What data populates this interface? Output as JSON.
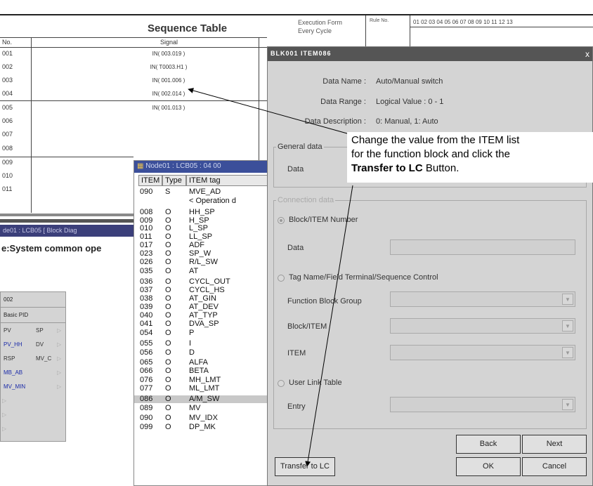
{
  "sequence_table": {
    "title": "Sequence Table",
    "exec_form_label": "Execution Form",
    "exec_form_value": "Every Cycle",
    "rule_no_label": "Rule No.",
    "rule_numbers": "01  02  03  04  05  06  07  08  09  10  11  12  13",
    "col_no": "No.",
    "col_signal": "Signal",
    "rows": [
      {
        "no": "001",
        "signal": "IN( 003.019 )"
      },
      {
        "no": "002",
        "signal": "IN( T0003.H1 )"
      },
      {
        "no": "003",
        "signal": "IN( 001.006 )"
      },
      {
        "no": "004",
        "signal": "IN( 002.014 )"
      },
      {
        "no": "005",
        "signal": "IN( 001.013 )"
      },
      {
        "no": "006",
        "signal": ""
      },
      {
        "no": "007",
        "signal": ""
      },
      {
        "no": "008",
        "signal": ""
      },
      {
        "no": "009",
        "signal": ""
      },
      {
        "no": "010",
        "signal": ""
      },
      {
        "no": "011",
        "signal": ""
      }
    ]
  },
  "block_diagram": {
    "title": "de01 : LCB05  [ Block Diag",
    "subtitle": "e:System common ope",
    "fb_header": "002",
    "fb_name": "Basic PID",
    "pins": [
      {
        "left": "PV",
        "right": "SP"
      },
      {
        "left": "PV_HH",
        "right": "DV"
      },
      {
        "left": "RSP",
        "right": "MV_C"
      },
      {
        "left": "MB_AB",
        "right": ""
      },
      {
        "left": "MV_MIN",
        "right": ""
      }
    ]
  },
  "item_list": {
    "title": "Node01 : LCB05 : 04 00",
    "headers": [
      "ITEM",
      "Type",
      "ITEM tag"
    ],
    "rows": [
      {
        "item": "090",
        "type": "S",
        "tag": "MVE_AD"
      },
      {
        "item": "",
        "type": "",
        "tag": "< Operation d"
      },
      {
        "item": "008",
        "type": "O",
        "tag": "HH_SP"
      },
      {
        "item": "009",
        "type": "O",
        "tag": "H_SP"
      },
      {
        "item": "010",
        "type": "O",
        "tag": "L_SP"
      },
      {
        "item": "011",
        "type": "O",
        "tag": "LL_SP"
      },
      {
        "item": "017",
        "type": "O",
        "tag": "ADF"
      },
      {
        "item": "023",
        "type": "O",
        "tag": "SP_W"
      },
      {
        "item": "026",
        "type": "O",
        "tag": "R/L_SW"
      },
      {
        "item": "035",
        "type": "O",
        "tag": "AT"
      },
      {
        "item": "036",
        "type": "O",
        "tag": "CYCL_OUT"
      },
      {
        "item": "037",
        "type": "O",
        "tag": "CYCL_HS"
      },
      {
        "item": "038",
        "type": "O",
        "tag": "AT_GIN"
      },
      {
        "item": "039",
        "type": "O",
        "tag": "AT_DEV"
      },
      {
        "item": "040",
        "type": "O",
        "tag": "AT_TYP"
      },
      {
        "item": "041",
        "type": "O",
        "tag": "DVA_SP"
      },
      {
        "item": "054",
        "type": "O",
        "tag": "P"
      },
      {
        "item": "055",
        "type": "O",
        "tag": "I"
      },
      {
        "item": "056",
        "type": "O",
        "tag": "D"
      },
      {
        "item": "065",
        "type": "O",
        "tag": "ALFA"
      },
      {
        "item": "066",
        "type": "O",
        "tag": "BETA"
      },
      {
        "item": "076",
        "type": "O",
        "tag": "MH_LMT"
      },
      {
        "item": "077",
        "type": "O",
        "tag": "ML_LMT"
      },
      {
        "item": "086",
        "type": "O",
        "tag": "A/M_SW"
      },
      {
        "item": "089",
        "type": "O",
        "tag": "MV"
      },
      {
        "item": "090",
        "type": "O",
        "tag": "MV_IDX"
      },
      {
        "item": "099",
        "type": "O",
        "tag": "DP_MK"
      }
    ]
  },
  "dialog": {
    "title": "BLK001 ITEM086",
    "close": "x",
    "data_name_label": "Data Name :",
    "data_name_value": "Auto/Manual switch",
    "data_range_label": "Data Range :",
    "data_range_value": "Logical Value : 0 - 1",
    "data_desc_label": "Data Description :",
    "data_desc_value": "0: Manual, 1: Auto",
    "general_group": "General data",
    "data_label": "Data",
    "connection_group": "Connection data",
    "radio_block_item": "Block/ITEM Number",
    "data_label2": "Data",
    "radio_tag_name": "Tag Name/Field Terminal/Sequence Control",
    "fb_group_label": "Function Block Group",
    "block_item_label": "Block/ITEM",
    "item_label": "ITEM",
    "radio_user_link": "User Link Table",
    "entry_label": "Entry",
    "back": "Back",
    "next": "Next",
    "transfer": "Transfer to LC",
    "ok": "OK",
    "cancel": "Cancel"
  },
  "callout": {
    "line1": "Change the value from the ITEM list",
    "line2": "for the function block and click the",
    "bold": "Transfer to LC",
    "after": " Button."
  }
}
